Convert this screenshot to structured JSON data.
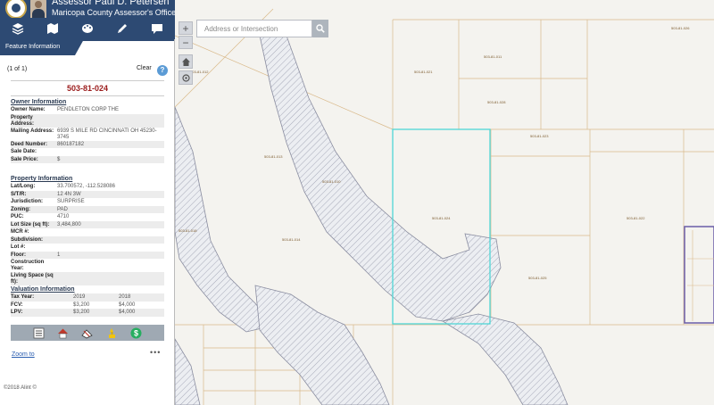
{
  "header": {
    "title": "Assessor Paul D. Petersen",
    "subtitle": "Maricopa County Assessor's Office"
  },
  "toolbar": {
    "items": [
      {
        "icon": "layers-icon"
      },
      {
        "icon": "basemap-icon"
      },
      {
        "icon": "palette-icon"
      },
      {
        "icon": "pencil-icon"
      },
      {
        "icon": "comment-icon"
      }
    ]
  },
  "panel": {
    "tab_label": "Feature Information",
    "count": "(1 of 1)",
    "clear_label": "Clear",
    "help_label": "?",
    "parcel_number": "503-81-024"
  },
  "owner": {
    "title": "Owner Information",
    "rows": [
      {
        "k": "Owner Name:",
        "v": "PENDLETON CORP THE"
      },
      {
        "k": "Property Address:",
        "v": ""
      },
      {
        "k": "Mailing Address:",
        "v": "6939 S MILE RD CINCINNATI OH 45230-3745"
      },
      {
        "k": "Deed Number:",
        "v": "860187182"
      },
      {
        "k": "Sale Date:",
        "v": ""
      },
      {
        "k": "Sale Price:",
        "v": "$"
      }
    ]
  },
  "property": {
    "title": "Property Information",
    "rows": [
      {
        "k": "Lat/Long:",
        "v": "33.700572, -112.528086"
      },
      {
        "k": "S/T/R:",
        "v": "12 4N 3W"
      },
      {
        "k": "Jurisdiction:",
        "v": "SURPRISE"
      },
      {
        "k": "Zoning:",
        "v": "PAD"
      },
      {
        "k": "PUC:",
        "v": "4710"
      },
      {
        "k": "Lot Size (sq ft):",
        "v": "3,484,800"
      },
      {
        "k": "MCR #:",
        "v": ""
      },
      {
        "k": "Subdivision:",
        "v": ""
      },
      {
        "k": "Lot #:",
        "v": ""
      },
      {
        "k": "Floor:",
        "v": "1"
      },
      {
        "k": "Construction Year:",
        "v": ""
      },
      {
        "k": "Living Space (sq ft):",
        "v": ""
      }
    ]
  },
  "valuation": {
    "title": "Valuation Information",
    "rows": [
      {
        "k": "Tax Year:",
        "a": "2019",
        "b": "2018"
      },
      {
        "k": "FCV:",
        "a": "$3,200",
        "b": "$4,000"
      },
      {
        "k": "LPV:",
        "a": "$3,200",
        "b": "$4,000"
      }
    ]
  },
  "actions": [
    {
      "icon": "list-icon"
    },
    {
      "icon": "home-icon"
    },
    {
      "icon": "map-icon"
    },
    {
      "icon": "flag-icon"
    },
    {
      "icon": "dollar-icon"
    }
  ],
  "links": {
    "zoom_to": "Zoom to",
    "more": "•••"
  },
  "footer": {
    "copyright": "©2018 Alint ©"
  },
  "map": {
    "zoom_in": "+",
    "zoom_out": "−",
    "search_placeholder": "Address or Intersection",
    "labels": [
      "503-81-012",
      "503-81-013",
      "503-81-014",
      "503-81-018",
      "503-81-010",
      "503-81-011",
      "503-81-028",
      "503-81-024",
      "503-81-023",
      "503-81-025",
      "503-81-021",
      "503-81-022",
      "503-81-026"
    ],
    "colors": {
      "selected": "#4fd6d6",
      "parcel_line": "#d9b98a",
      "hatch": "#a6a9b8",
      "boundary": "#6a5da8"
    }
  }
}
